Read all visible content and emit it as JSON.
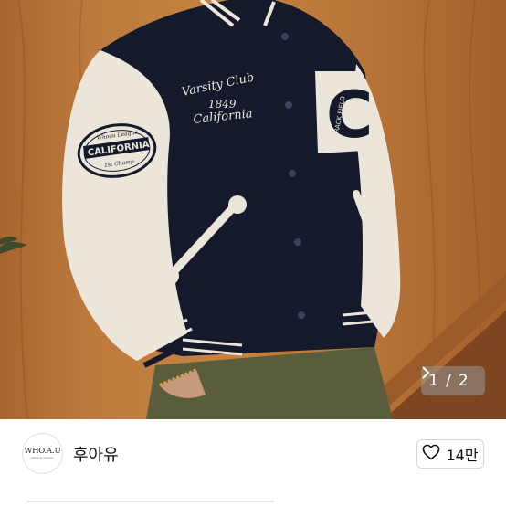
{
  "photo": {
    "alt_icon": "product-photo",
    "pager": {
      "current": "1",
      "separator": "/",
      "total": "2",
      "next_icon": "chevron-right-icon"
    },
    "jacket_text": {
      "chest_line1": "Varsity Club",
      "chest_line2": "1849",
      "chest_line3": "California",
      "patch_top": "Whoau League",
      "patch_main": "CALIFORNIA",
      "patch_bottom": "1st Champ.",
      "letter": "C",
      "letter_side": "TRACK FIELD"
    }
  },
  "seller": {
    "avatar_text": "WHO.A.U",
    "avatar_sub": "Steve & Yvonne",
    "name": "후아유",
    "like_icon": "heart-outline-icon",
    "likes": "14만"
  },
  "colors": {
    "jacket_body": "#141a2b",
    "sleeve": "#ece6da",
    "wall": "#c07d3e"
  }
}
